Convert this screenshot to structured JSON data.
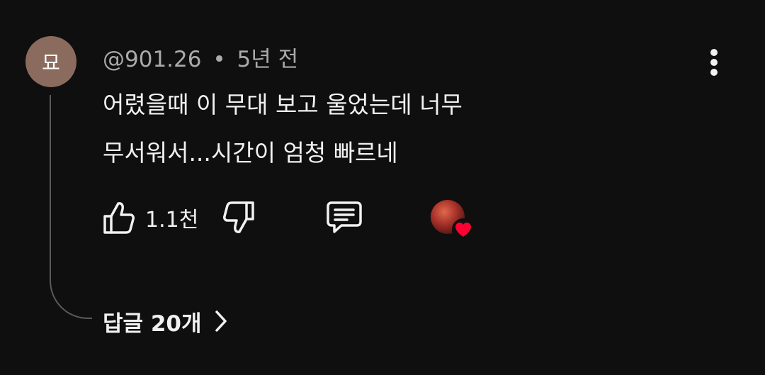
{
  "comment": {
    "avatar_letter": "묘",
    "avatar_color": "#8c6b5f",
    "author": "@901.26",
    "separator": "•",
    "time": "5년 전",
    "text": "어렸을때 이 무대 보고 울었는데 너무\n무서워서...시간이 엄청 빠르네",
    "like_count": "1.1천",
    "replies_label": "답글 20개"
  },
  "icons": {
    "more": "more-vertical-icon",
    "like": "thumbs-up-icon",
    "dislike": "thumbs-down-icon",
    "reply": "comment-icon",
    "heart": "heart-icon",
    "chevron": "chevron-right-icon"
  },
  "colors": {
    "background": "#0f0f0f",
    "text_primary": "#f1f1f1",
    "text_secondary": "#aaaaaa",
    "heart": "#ff0033"
  }
}
